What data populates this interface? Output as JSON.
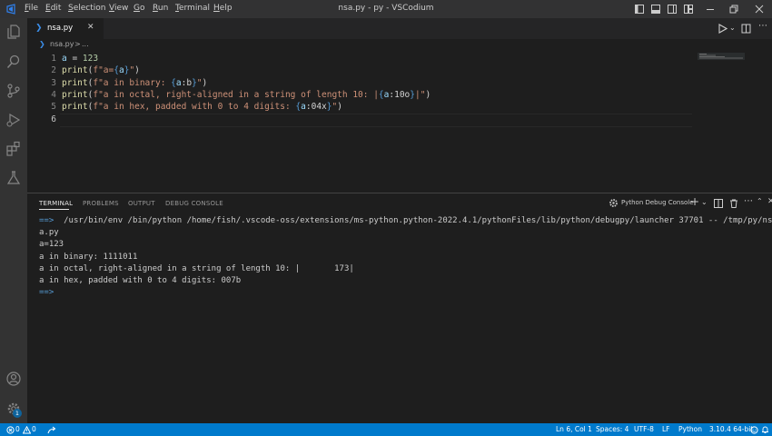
{
  "titlebar": {
    "title": "nsa.py - py - VSCodium",
    "menu": [
      {
        "label": "File",
        "key": "F",
        "rest": "ile"
      },
      {
        "label": "Edit",
        "key": "E",
        "rest": "dit"
      },
      {
        "label": "Selection",
        "key": "S",
        "rest": "election"
      },
      {
        "label": "View",
        "key": "V",
        "rest": "iew"
      },
      {
        "label": "Go",
        "key": "G",
        "rest": "o"
      },
      {
        "label": "Run",
        "key": "R",
        "rest": "un"
      },
      {
        "label": "Terminal",
        "key": "T",
        "rest": "erminal"
      },
      {
        "label": "Help",
        "key": "H",
        "rest": "elp"
      }
    ]
  },
  "activity_bar": {
    "icons": [
      "explorer-icon",
      "search-icon",
      "source-control-icon",
      "run-debug-icon",
      "extensions-icon",
      "testing-icon"
    ],
    "bottom_icons": [
      "account-icon",
      "settings-gear-icon"
    ],
    "settings_badge": "1"
  },
  "tabs": [
    {
      "label": "nsa.py",
      "close": "✕"
    }
  ],
  "breadcrumb": {
    "file": "nsa.py",
    "sep": ">",
    "rest": "..."
  },
  "editor": {
    "lines": [
      {
        "n": "1",
        "parts": [
          [
            "var",
            "a"
          ],
          [
            "plain",
            " = "
          ],
          [
            "num",
            "123"
          ]
        ]
      },
      {
        "n": "2",
        "parts": [
          [
            "fn",
            "print"
          ],
          [
            "plain",
            "("
          ],
          [
            "str",
            "f\"a="
          ],
          [
            "brace",
            "{"
          ],
          [
            "var",
            "a"
          ],
          [
            "brace",
            "}"
          ],
          [
            "str",
            "\""
          ],
          [
            "plain",
            ")"
          ]
        ]
      },
      {
        "n": "3",
        "parts": [
          [
            "fn",
            "print"
          ],
          [
            "plain",
            "("
          ],
          [
            "str",
            "f\"a in binary: "
          ],
          [
            "brace",
            "{"
          ],
          [
            "var",
            "a"
          ],
          [
            "plain",
            ":b"
          ],
          [
            "brace",
            "}"
          ],
          [
            "str",
            "\""
          ],
          [
            "plain",
            ")"
          ]
        ]
      },
      {
        "n": "4",
        "parts": [
          [
            "fn",
            "print"
          ],
          [
            "plain",
            "("
          ],
          [
            "str",
            "f\"a in octal, right-aligned in a string of length 10: |"
          ],
          [
            "brace",
            "{"
          ],
          [
            "var",
            "a"
          ],
          [
            "plain",
            ":10o"
          ],
          [
            "brace",
            "}"
          ],
          [
            "str",
            "|\""
          ],
          [
            "plain",
            ")"
          ]
        ]
      },
      {
        "n": "5",
        "parts": [
          [
            "fn",
            "print"
          ],
          [
            "plain",
            "("
          ],
          [
            "str",
            "f\"a in hex, padded with 0 to 4 digits: "
          ],
          [
            "brace",
            "{"
          ],
          [
            "var",
            "a"
          ],
          [
            "plain",
            ":04x"
          ],
          [
            "brace",
            "}"
          ],
          [
            "str",
            "\""
          ],
          [
            "plain",
            ")"
          ]
        ]
      },
      {
        "n": "6",
        "parts": []
      }
    ]
  },
  "panel": {
    "tabs": [
      "TERMINAL",
      "PROBLEMS",
      "OUTPUT",
      "DEBUG CONSOLE"
    ],
    "active_tab": "TERMINAL",
    "terminal_selector": "Python Debug Console",
    "terminal_lines": [
      {
        "prompt": "==>",
        "text": "  /usr/bin/env /bin/python /home/fish/.vscode-oss/extensions/ms-python.python-2022.4.1/pythonFiles/lib/python/debugpy/launcher 37701 -- /tmp/py/ns"
      },
      {
        "prompt": "",
        "text": "a.py"
      },
      {
        "prompt": "",
        "text": "a=123"
      },
      {
        "prompt": "",
        "text": "a in binary: 1111011"
      },
      {
        "prompt": "",
        "text": "a in octal, right-aligned in a string of length 10: |       173|"
      },
      {
        "prompt": "",
        "text": "a in hex, padded with 0 to 4 digits: 007b"
      },
      {
        "prompt": "==>",
        "text": ""
      }
    ]
  },
  "statusbar": {
    "errors": "0",
    "warnings": "0",
    "position": "Ln 6, Col 1",
    "spaces": "Spaces: 4",
    "encoding": "UTF-8",
    "eol": "LF",
    "language": "Python",
    "interpreter": "3.10.4 64-bit"
  },
  "colors": {
    "statusbar": "#007acc",
    "activity_bar": "#333333",
    "editor_bg": "#1e1e1e"
  }
}
